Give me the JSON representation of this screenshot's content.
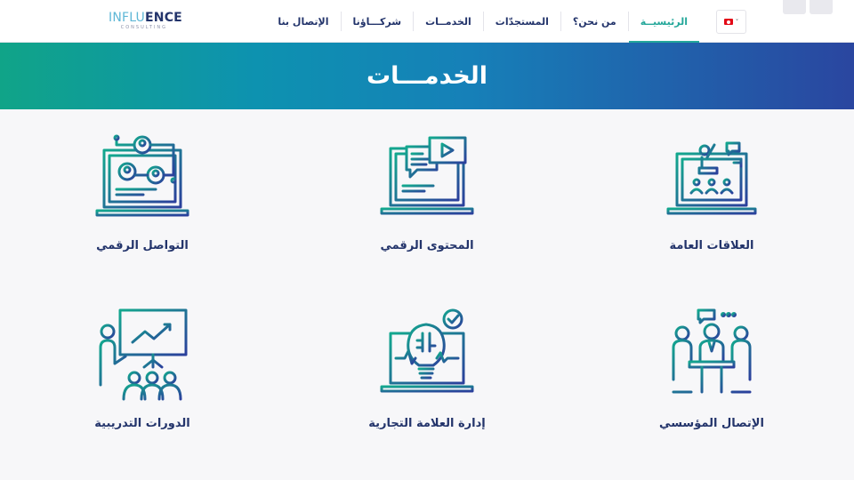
{
  "header": {
    "logo": {
      "main_light": "INFLU",
      "main_bold": "ENCE",
      "sub": "CONSULTING"
    },
    "nav": [
      {
        "label": "الرئيسيــة",
        "active": true
      },
      {
        "label": "من نحن؟",
        "active": false
      },
      {
        "label": "المستجدّات",
        "active": false
      },
      {
        "label": "الخدمــات",
        "active": false
      },
      {
        "label": "شركـــاؤنا",
        "active": false
      },
      {
        "label": "الإتصال بنا",
        "active": false
      }
    ],
    "language": {
      "selected": "tn-flag",
      "caret": "˅"
    }
  },
  "banner": {
    "title": "الخدمـــات"
  },
  "services": [
    {
      "label": "العلاقات العامة",
      "icon": "public-relations-icon"
    },
    {
      "label": "المحتوى الرقمي",
      "icon": "digital-content-icon"
    },
    {
      "label": "التواصل الرقمي",
      "icon": "digital-communication-icon"
    },
    {
      "label": "الإتصال المؤسسي",
      "icon": "corporate-communication-icon"
    },
    {
      "label": "إدارة العلامة التجارية",
      "icon": "brand-management-icon"
    },
    {
      "label": "الدورات التدريبية",
      "icon": "training-courses-icon"
    }
  ],
  "colors": {
    "accent": "#24a79a",
    "navy": "#23346b",
    "gradient_start": "#10a488",
    "gradient_end": "#2a46a0"
  }
}
